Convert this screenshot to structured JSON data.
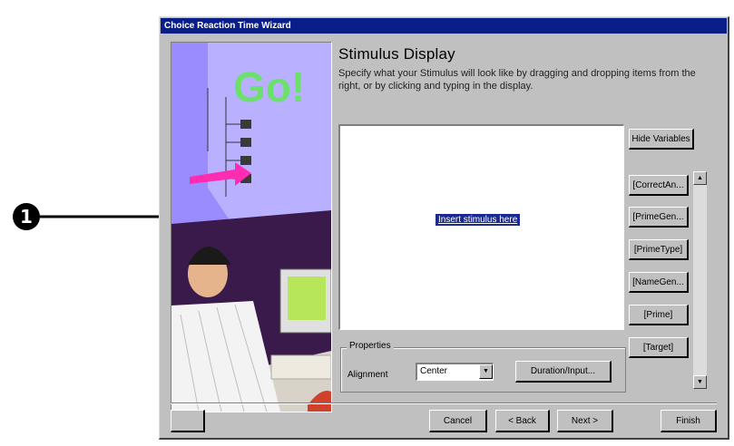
{
  "callout": {
    "number": "1"
  },
  "window": {
    "title": "Choice Reaction Time Wizard"
  },
  "main": {
    "heading": "Stimulus  Display",
    "instructions": "Specify what your Stimulus will look like by dragging and dropping items from the right, or by clicking and typing in the display.",
    "placeholder": "Insert stimulus here"
  },
  "variables": {
    "hide_label": "Hide Variables",
    "items": [
      "[CorrectAn...",
      "[PrimeGen...",
      "[PrimeType]",
      "[NameGen...",
      "[Prime]",
      "[Target]"
    ]
  },
  "properties": {
    "group_label": "Properties",
    "alignment_label": "Alignment",
    "alignment_value": "Center",
    "duration_label": "Duration/Input..."
  },
  "footer": {
    "cancel": "Cancel",
    "back": "< Back",
    "next": "Next >",
    "finish": "Finish"
  }
}
